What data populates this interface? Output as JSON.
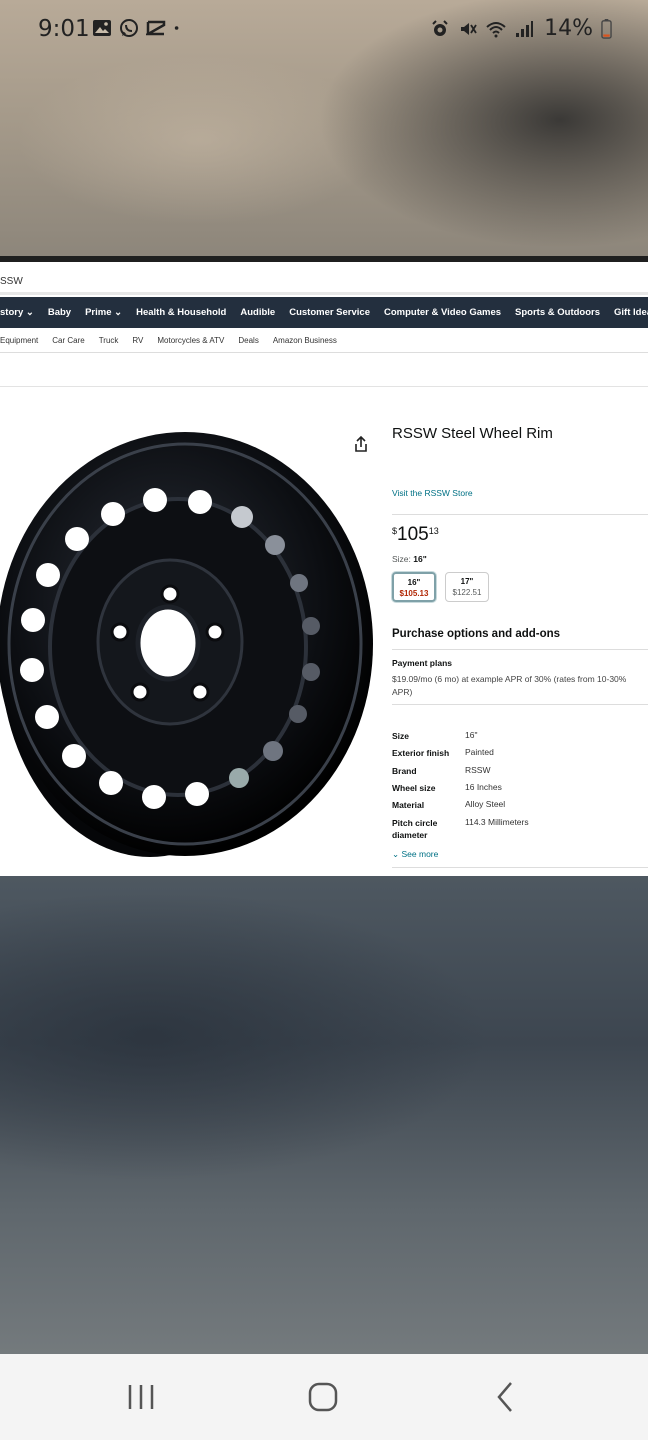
{
  "status_bar": {
    "time": "9:01",
    "battery": "14%",
    "icons_left": [
      "gallery-icon",
      "whatsapp-icon",
      "capcut-icon",
      "dot-icon"
    ],
    "icons_right": [
      "alarm-icon",
      "mute-icon",
      "wifi-icon",
      "signal-icon",
      "battery-icon"
    ]
  },
  "browser": {
    "site_label": "SSW",
    "nav_main": [
      "story ⌄",
      "Baby",
      "Prime ⌄",
      "Health & Household",
      "Audible",
      "Customer Service",
      "Computer & Video Games",
      "Sports & Outdoors",
      "Gift Ideas"
    ],
    "nav_sub": [
      "Equipment",
      "Car Care",
      "Truck",
      "RV",
      "Motorcycles & ATV",
      "Deals",
      "Amazon Business"
    ]
  },
  "product": {
    "title": "RSSW Steel Wheel Rim",
    "store_link": "Visit the RSSW Store",
    "price_symbol": "$",
    "price_whole": "105",
    "price_fraction": "13",
    "size_label": "Size:",
    "size_value": "16\"",
    "size_options": [
      {
        "size": "16\"",
        "price": "$105.13",
        "selected": true
      },
      {
        "size": "17\"",
        "price": "$122.51",
        "selected": false
      }
    ],
    "purchase_heading": "Purchase options and add-ons",
    "payment_label": "Payment plans",
    "payment_text": "$19.09/mo (6 mo) at example APR of 30% (rates from 10-30% APR)",
    "specs": [
      {
        "key": "Size",
        "value": "16\""
      },
      {
        "key": "Exterior finish",
        "value": "Painted"
      },
      {
        "key": "Brand",
        "value": "RSSW"
      },
      {
        "key": "Wheel size",
        "value": "16 Inches"
      },
      {
        "key": "Material",
        "value": "Alloy Steel"
      },
      {
        "key": "Pitch circle diameter",
        "value": "114.3 Millimeters"
      }
    ],
    "see_more": "See more"
  },
  "colors": {
    "nav_dark": "#232f3e",
    "link": "#007185",
    "price_red": "#b12704"
  }
}
